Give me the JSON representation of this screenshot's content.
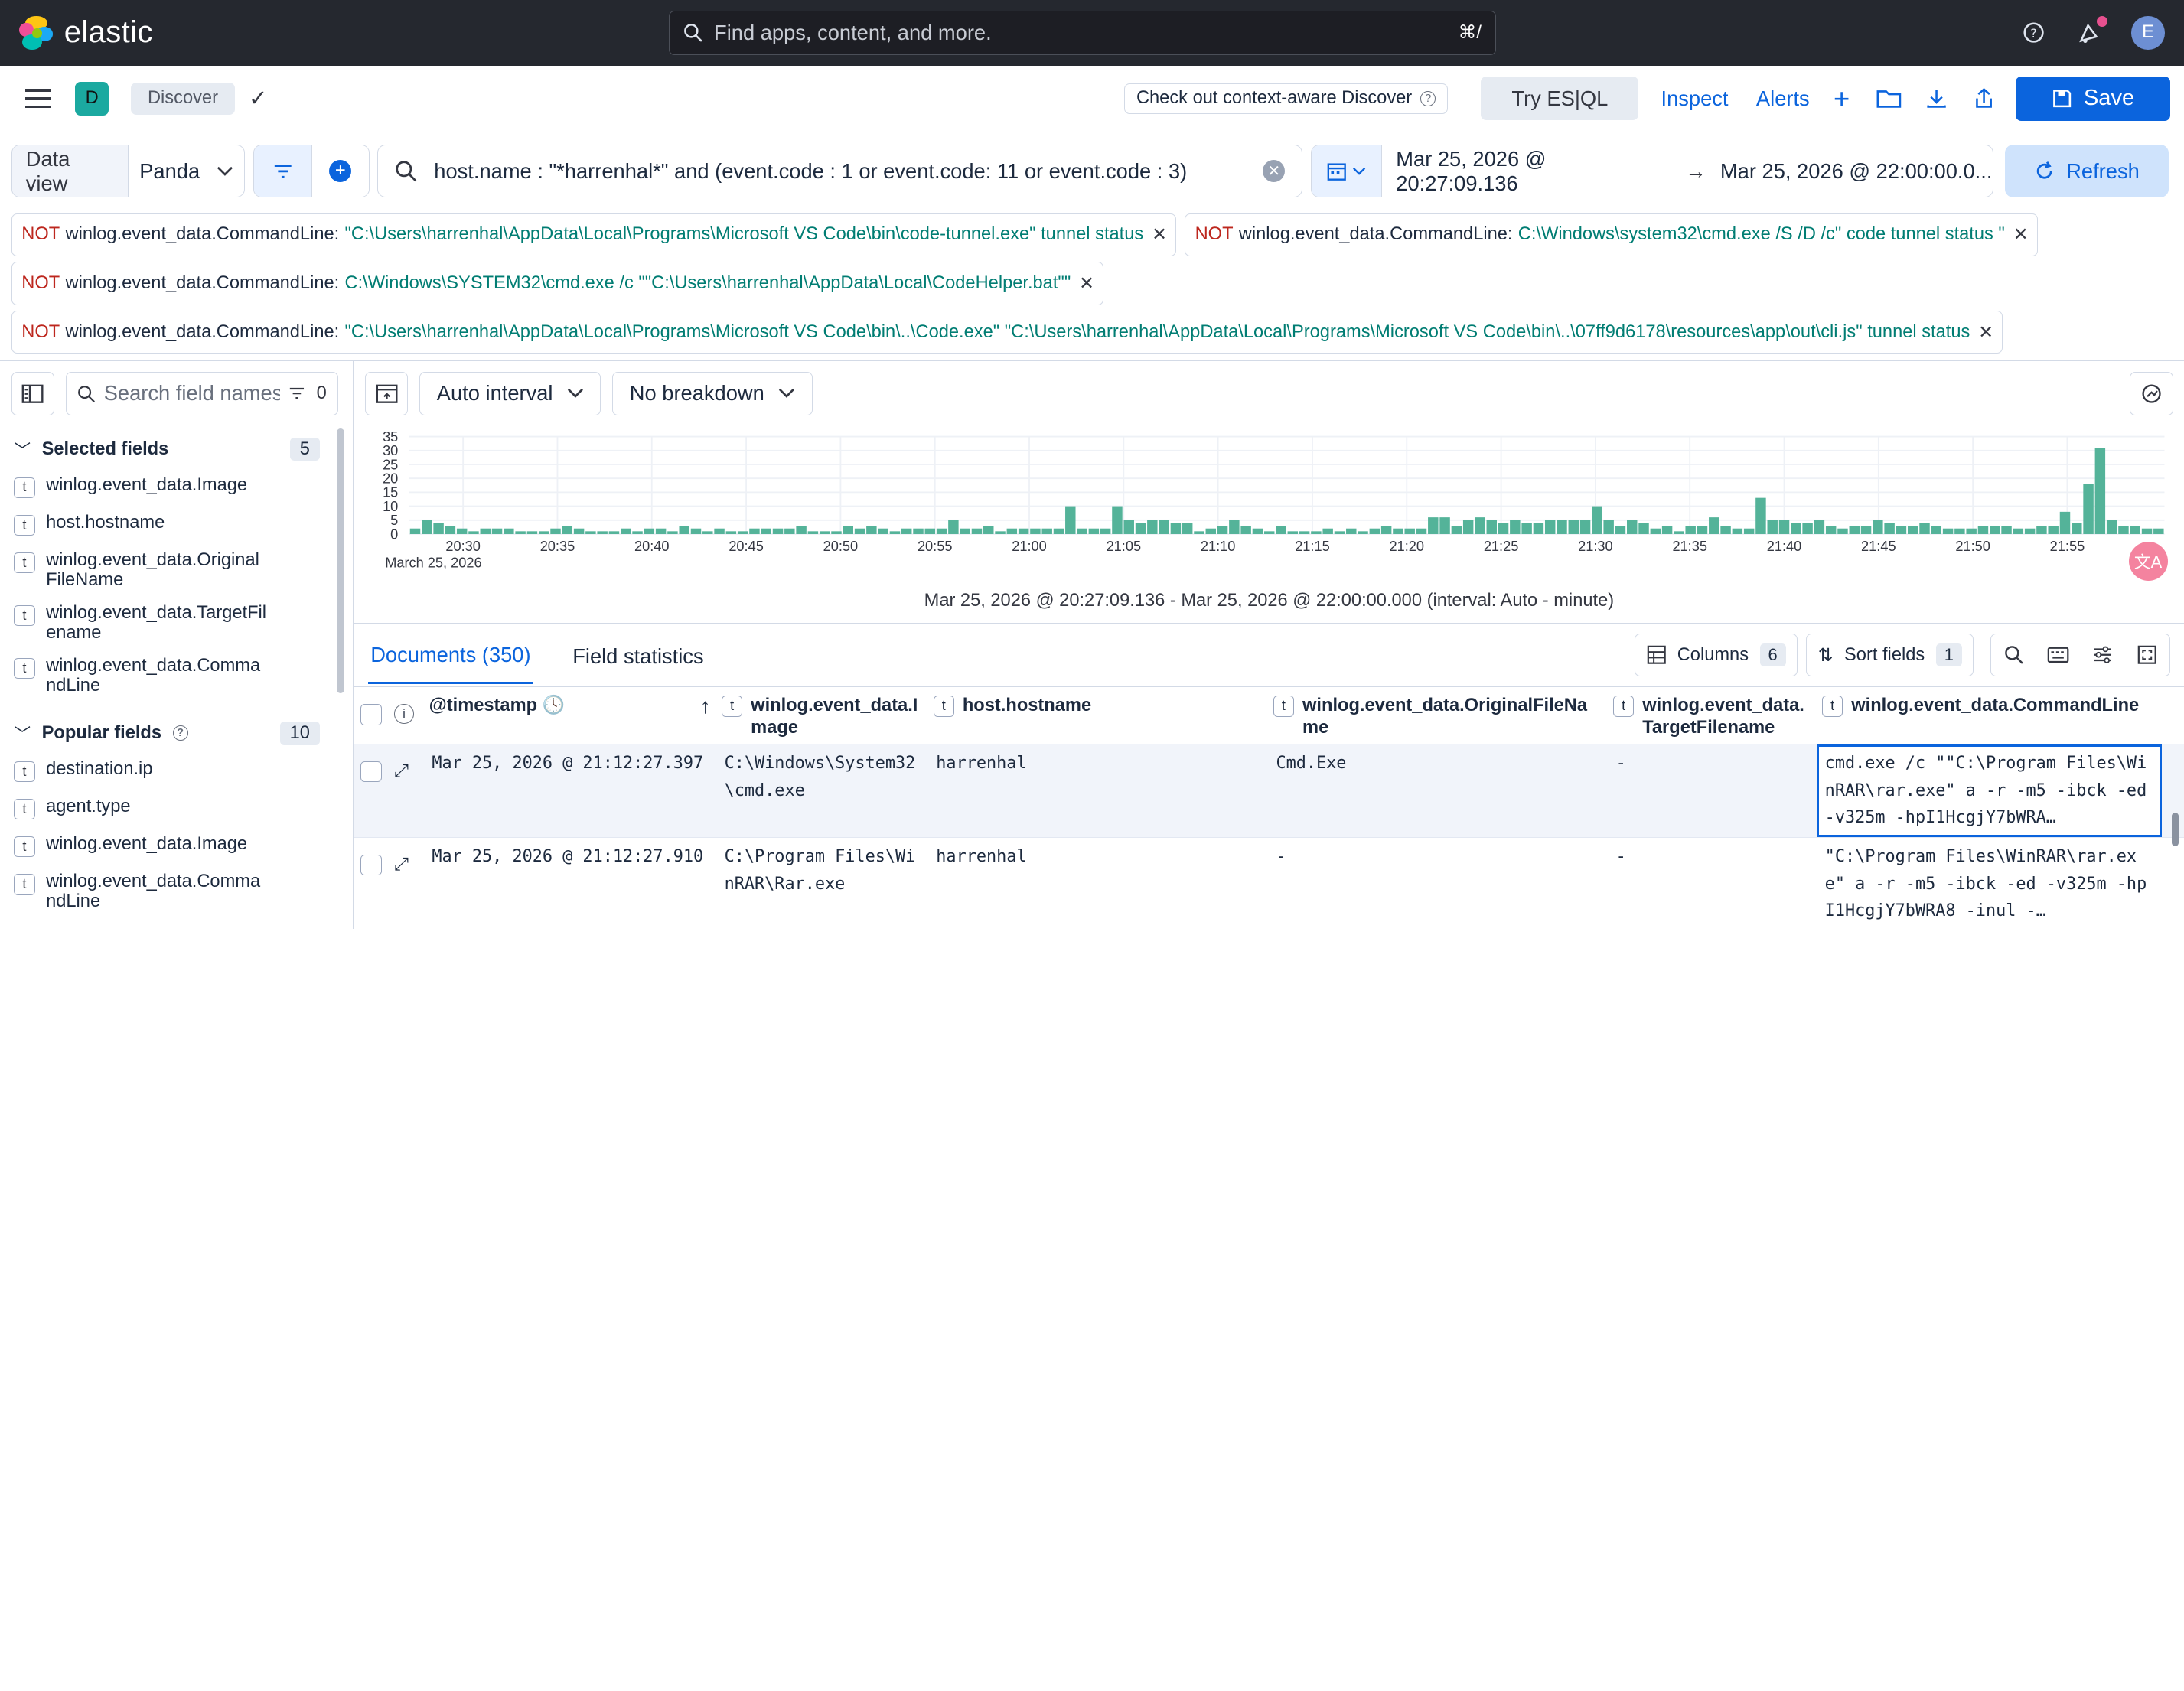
{
  "topbar": {
    "logo_text": "elastic",
    "search_placeholder": "Find apps, content, and more.",
    "search_shortcut": "⌘/",
    "avatar_initial": "E"
  },
  "appbar": {
    "space_initial": "D",
    "breadcrumb": "Discover",
    "callout": "Check out context-aware Discover",
    "try_esql": "Try ES|QL",
    "inspect": "Inspect",
    "alerts": "Alerts",
    "save": "Save"
  },
  "querybar": {
    "data_view_label": "Data view",
    "data_view_value": "Panda",
    "query": "host.name : \"*harrenhal*\" and (event.code : 1 or event.code: 11 or event.code : 3)",
    "date_start": "Mar 25, 2026 @ 20:27:09.136",
    "date_end": "Mar 25, 2026 @ 22:00:00.0...",
    "refresh": "Refresh"
  },
  "filters": [
    {
      "not": "NOT",
      "field": "winlog.event_data.CommandLine:",
      "value": "\"C:\\Users\\harrenhal\\AppData\\Local\\Programs\\Microsoft VS Code\\bin\\code-tunnel.exe\" tunnel status"
    },
    {
      "not": "NOT",
      "field": "winlog.event_data.CommandLine:",
      "value": "C:\\Windows\\system32\\cmd.exe /S /D /c\" code tunnel status \""
    },
    {
      "not": "NOT",
      "field": "winlog.event_data.CommandLine:",
      "value": "C:\\Windows\\SYSTEM32\\cmd.exe /c \"\"C:\\Users\\harrenhal\\AppData\\Local\\CodeHelper.bat\"\""
    },
    {
      "not": "NOT",
      "field": "winlog.event_data.CommandLine:",
      "value": "\"C:\\Users\\harrenhal\\AppData\\Local\\Programs\\Microsoft VS Code\\bin\\..\\Code.exe\" \"C:\\Users\\harrenhal\\AppData\\Local\\Programs\\Microsoft VS Code\\bin\\..\\07ff9d6178\\resources\\app\\out\\cli.js\" tunnel status"
    }
  ],
  "sidebar": {
    "search_placeholder": "Search field names",
    "filter_count": "0",
    "selected_title": "Selected fields",
    "selected_count": "5",
    "selected_fields": [
      "winlog.event_data.Image",
      "host.hostname",
      "winlog.event_data.OriginalFileName",
      "winlog.event_data.TargetFilename",
      "winlog.event_data.CommandLine"
    ],
    "popular_title": "Popular fields",
    "popular_count": "10",
    "popular_fields": [
      "destination.ip",
      "agent.type",
      "winlog.event_data.Image",
      "winlog.event_data.CommandLine"
    ]
  },
  "histogram": {
    "interval": "Auto interval",
    "breakdown": "No breakdown",
    "interval_label": "Mar 25, 2026 @ 20:27:09.136 - Mar 25, 2026 @ 22:00:00.000 (interval: Auto - minute)",
    "fab_label": "文A"
  },
  "chart_data": {
    "type": "bar",
    "ylim": [
      0,
      35
    ],
    "y_ticks": [
      "35",
      "30",
      "25",
      "20",
      "15",
      "10",
      "5",
      "0"
    ],
    "x_ticks": [
      "20:30",
      "20:35",
      "20:40",
      "20:45",
      "20:50",
      "20:55",
      "21:00",
      "21:05",
      "21:10",
      "21:15",
      "21:20",
      "21:25",
      "21:30",
      "21:35",
      "21:40",
      "21:45",
      "21:50",
      "21:55"
    ],
    "x_date_label": "March 25, 2026",
    "bar_color": "#54b399",
    "values": [
      2,
      5,
      4,
      3,
      2,
      1,
      2,
      2,
      2,
      1,
      1,
      1,
      2,
      3,
      2,
      1,
      1,
      1,
      2,
      1,
      2,
      2,
      1,
      3,
      2,
      1,
      2,
      1,
      1,
      2,
      2,
      2,
      2,
      3,
      1,
      1,
      1,
      3,
      2,
      3,
      2,
      1,
      2,
      2,
      2,
      2,
      5,
      2,
      2,
      3,
      1,
      2,
      2,
      2,
      2,
      2,
      10,
      2,
      2,
      2,
      10,
      5,
      4,
      5,
      5,
      4,
      4,
      1,
      2,
      3,
      5,
      3,
      2,
      1,
      3,
      1,
      1,
      1,
      2,
      1,
      2,
      1,
      2,
      3,
      2,
      2,
      2,
      6,
      6,
      3,
      5,
      6,
      5,
      4,
      5,
      4,
      4,
      5,
      5,
      5,
      5,
      10,
      5,
      3,
      5,
      4,
      2,
      3,
      1,
      3,
      3,
      6,
      3,
      2,
      2,
      13,
      5,
      5,
      4,
      4,
      5,
      3,
      2,
      3,
      3,
      5,
      4,
      3,
      3,
      4,
      3,
      2,
      2,
      2,
      3,
      3,
      3,
      2,
      2,
      3,
      3,
      8,
      4,
      18,
      31,
      5,
      3,
      3,
      2,
      2
    ]
  },
  "tabs": {
    "documents": "Documents (350)",
    "field_stats": "Field statistics"
  },
  "grid_tools": {
    "columns": "Columns",
    "columns_count": "6",
    "sort": "Sort fields",
    "sort_count": "1"
  },
  "grid": {
    "headers": {
      "timestamp": "@timestamp",
      "image": "winlog.event_data.Image",
      "host": "host.hostname",
      "original": "winlog.event_data.OriginalFileName",
      "target": "winlog.event_data.TargetFilename",
      "cmd": "winlog.event_data.CommandLine"
    },
    "rows": [
      {
        "timestamp": "Mar 25, 2026 @ 21:12:27.397",
        "image": "C:\\Windows\\System32\\cmd.exe",
        "host": "harrenhal",
        "original": "Cmd.Exe",
        "target": "-",
        "cmd": "cmd.exe /c \"\"C:\\Program Files\\WinRAR\\rar.exe\" a -r -m5 -ibck -ed -v325m -hpI1HcgjY7bWRA…"
      },
      {
        "timestamp": "Mar 25, 2026 @ 21:12:27.910",
        "image": "C:\\Program Files\\WinRAR\\Rar.exe",
        "host": "harrenhal",
        "original": "-",
        "target": "-",
        "cmd": "\"C:\\Program Files\\WinRAR\\rar.exe\" a -r -m5 -ibck -ed -v325m -hpI1HcgjY7bWRA8 -inul -…"
      }
    ]
  }
}
